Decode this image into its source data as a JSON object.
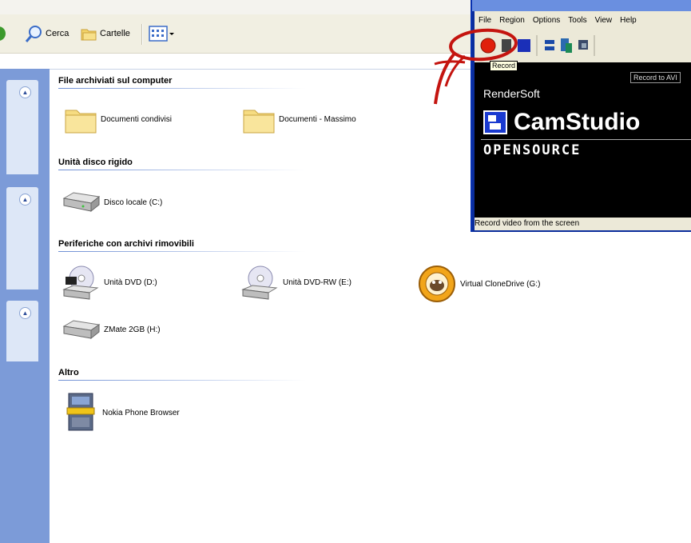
{
  "explorer": {
    "top_strip_text": "",
    "toolbar": {
      "search_label": "Cerca",
      "folders_label": "Cartelle"
    },
    "sections": [
      {
        "title": "File archiviati sul computer",
        "items": [
          {
            "label": "Documenti condivisi",
            "icon": "folder-icon"
          },
          {
            "label": "Documenti - Massimo",
            "icon": "folder-icon"
          }
        ]
      },
      {
        "title": "Unità disco rigido",
        "items": [
          {
            "label": "Disco locale (C:)",
            "icon": "hard-drive-icon"
          }
        ]
      },
      {
        "title": "Periferiche con archivi rimovibili",
        "items": [
          {
            "label": "Unità DVD (D:)",
            "icon": "dvd-drive-icon"
          },
          {
            "label": "Unità DVD-RW (E:)",
            "icon": "dvd-rw-drive-icon"
          },
          {
            "label": "Virtual CloneDrive (G:)",
            "icon": "clonedrive-icon"
          },
          {
            "label": "ZMate 2GB (H:)",
            "icon": "removable-drive-icon"
          }
        ]
      },
      {
        "title": "Altro",
        "items": [
          {
            "label": "Nokia Phone Browser",
            "icon": "phone-browser-icon"
          }
        ]
      }
    ]
  },
  "camstudio": {
    "menu": [
      "File",
      "Region",
      "Options",
      "Tools",
      "View",
      "Help"
    ],
    "tooltip": "Record",
    "record_to_avi": "Record to AVI",
    "vendor": "RenderSoft",
    "product": "CamStudio",
    "edition": "OPENSOURCE",
    "status": "Record video from the screen"
  },
  "colors": {
    "sidebar": "#7c9bd8",
    "toolbar": "#f1efe2",
    "record_button": "#e0200c",
    "annotation": "#c4140f"
  }
}
